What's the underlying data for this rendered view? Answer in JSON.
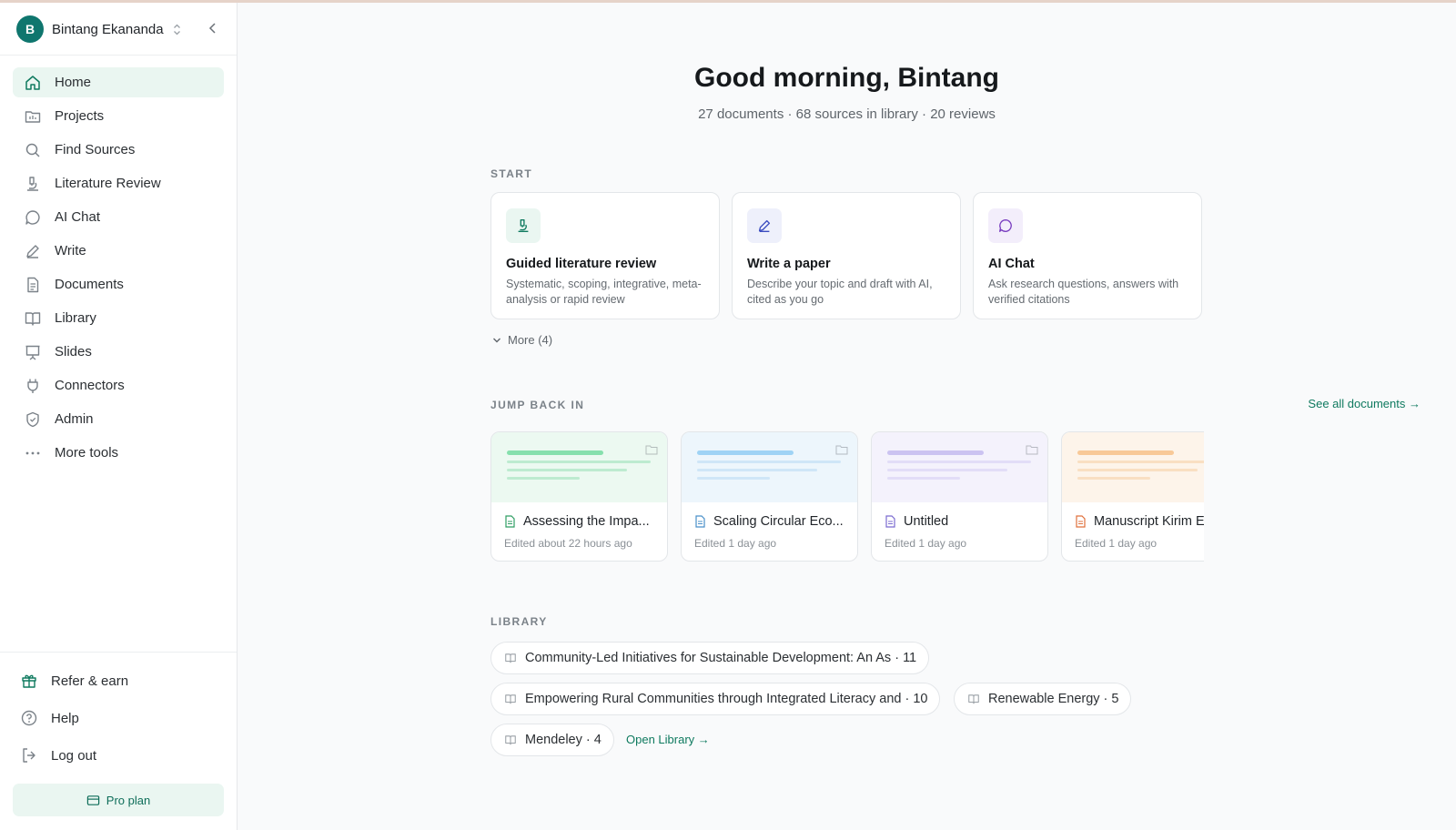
{
  "user": {
    "initial": "B",
    "name": "Bintang Ekananda"
  },
  "nav": [
    {
      "label": "Home",
      "icon": "home-icon",
      "active": true
    },
    {
      "label": "Projects",
      "icon": "folder-icon"
    },
    {
      "label": "Find Sources",
      "icon": "search-icon"
    },
    {
      "label": "Literature Review",
      "icon": "microscope-icon"
    },
    {
      "label": "AI Chat",
      "icon": "chat-icon"
    },
    {
      "label": "Write",
      "icon": "pen-icon"
    },
    {
      "label": "Documents",
      "icon": "document-icon"
    },
    {
      "label": "Library",
      "icon": "book-icon"
    },
    {
      "label": "Slides",
      "icon": "presentation-icon"
    },
    {
      "label": "Connectors",
      "icon": "plug-icon"
    },
    {
      "label": "Admin",
      "icon": "shield-icon"
    },
    {
      "label": "More tools",
      "icon": "ellipsis-icon"
    }
  ],
  "bottom_nav": [
    {
      "label": "Refer & earn",
      "icon": "gift-icon"
    },
    {
      "label": "Help",
      "icon": "help-icon"
    },
    {
      "label": "Log out",
      "icon": "logout-icon"
    }
  ],
  "plan": {
    "label": "Pro plan"
  },
  "header": {
    "greeting": "Good morning, Bintang",
    "stats": "27 documents · 68 sources in library · 20 reviews"
  },
  "start": {
    "label": "START",
    "cards": [
      {
        "title": "Guided literature review",
        "desc": "Systematic, scoping, integrative, meta-analysis or rapid review",
        "icon": "microscope-icon",
        "color": "#0f7a5f",
        "bg": "#eaf6f1"
      },
      {
        "title": "Write a paper",
        "desc": "Describe your topic and draft with AI, cited as you go",
        "icon": "pen-icon",
        "color": "#3b4cc0",
        "bg": "#eef0fb"
      },
      {
        "title": "AI Chat",
        "desc": "Ask research questions, answers with verified citations",
        "icon": "chat-icon",
        "color": "#7a3fc0",
        "bg": "#f3eefb"
      }
    ],
    "more": "More (4)"
  },
  "jump": {
    "label": "JUMP BACK IN",
    "see_all": "See all documents →",
    "docs": [
      {
        "title": "Assessing the Impa...",
        "edited": "Edited about 22 hours ago",
        "icon": "document-icon",
        "accent": "#86e0ad",
        "bg": "#ecf9f1",
        "icon_color": "#2f9e63"
      },
      {
        "title": "Scaling Circular Eco...",
        "edited": "Edited 1 day ago",
        "icon": "document-icon",
        "accent": "#9fd3f5",
        "bg": "#edf6fc",
        "icon_color": "#4a90c9"
      },
      {
        "title": "Untitled",
        "edited": "Edited 1 day ago",
        "icon": "document-icon",
        "accent": "#cbc3f1",
        "bg": "#f4f2fc",
        "icon_color": "#7b6bd0"
      },
      {
        "title": "Manuscript Kirim E",
        "edited": "Edited 1 day ago",
        "icon": "document-icon",
        "accent": "#f8c998",
        "bg": "#fdf4ea",
        "icon_color": "#e0703c"
      }
    ]
  },
  "library": {
    "label": "LIBRARY",
    "chips": [
      {
        "label": "Community-Led Initiatives for Sustainable Development: An As · 11"
      },
      {
        "label": "Empowering Rural Communities through Integrated Literacy and · 10"
      },
      {
        "label": "Renewable Energy · 5"
      },
      {
        "label": "Mendeley · 4"
      }
    ],
    "open": "Open Library →"
  }
}
